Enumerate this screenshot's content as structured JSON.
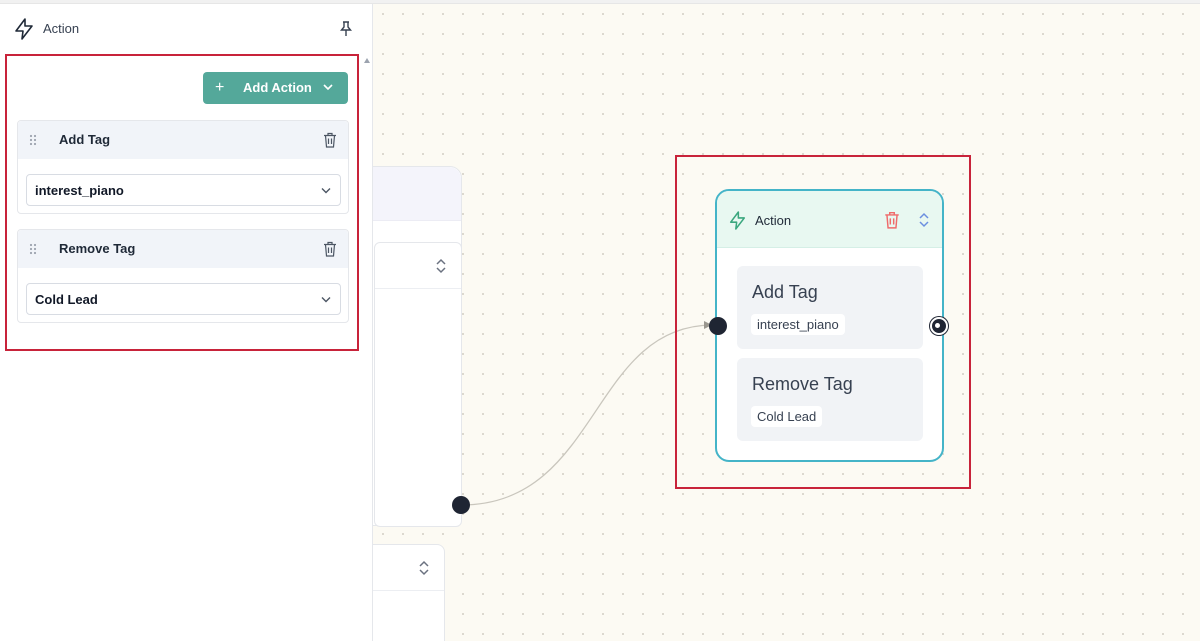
{
  "sidebar": {
    "title": "Action",
    "add_action_label": "Add Action",
    "items": [
      {
        "label": "Add Tag",
        "selected": "interest_piano"
      },
      {
        "label": "Remove Tag",
        "selected": "Cold Lead"
      }
    ]
  },
  "node": {
    "title": "Action",
    "cards": [
      {
        "title": "Add Tag",
        "tag": "interest_piano"
      },
      {
        "title": "Remove Tag",
        "tag": "Cold Lead"
      }
    ]
  },
  "colors": {
    "accent": "#54a89a",
    "node_border": "#44b4c8",
    "node_header": "#e8f8f1",
    "highlight": "#c8233a",
    "icon_green": "#3aa77e",
    "trash_red": "#ef6b6b",
    "updown_blue": "#6b8fe0"
  },
  "icons": {
    "panel": "lightning-bolt-icon",
    "pin": "pin-icon",
    "drag": "drag-handle-icon",
    "delete": "trash-icon",
    "expand": "chevron-down-icon",
    "reorder": "up-down-icon"
  }
}
